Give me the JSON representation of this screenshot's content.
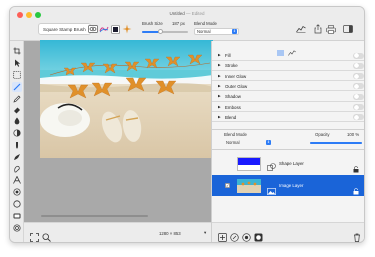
{
  "window": {
    "title": "Untitled",
    "status": "— Edited"
  },
  "toolbar": {
    "brush_button": "Square Stamp Brush",
    "brush_size_label": "Brush Size",
    "brush_size_value": "187 px",
    "brush_size_level": 0.4,
    "blend_mode_label": "Blend Mode",
    "blend_mode_value": "Normal"
  },
  "canvas": {
    "dimensions": "1280 × 853"
  },
  "effects": [
    {
      "label": "Fill",
      "enabled": false
    },
    {
      "label": "Stroke",
      "enabled": false
    },
    {
      "label": "Inner Glow",
      "enabled": false
    },
    {
      "label": "Outer Glow",
      "enabled": false
    },
    {
      "label": "Shadow",
      "enabled": false
    },
    {
      "label": "Emboss",
      "enabled": false
    },
    {
      "label": "Blend",
      "enabled": false
    }
  ],
  "layer_settings": {
    "blend_mode_label": "Blend Mode",
    "blend_mode_value": "Normal",
    "opacity_label": "Opacity",
    "opacity_value": "100 %",
    "opacity_level": 1.0
  },
  "layers": [
    {
      "name": "Shape Layer",
      "selected": false,
      "visible": false
    },
    {
      "name": "Image Layer",
      "selected": true,
      "visible": true
    }
  ],
  "colors": {
    "accent": "#2d7cf6",
    "selection": "#1a64d8",
    "canvas_bg": "#a9a9a9",
    "shape_thumb": "#1a1aff"
  }
}
